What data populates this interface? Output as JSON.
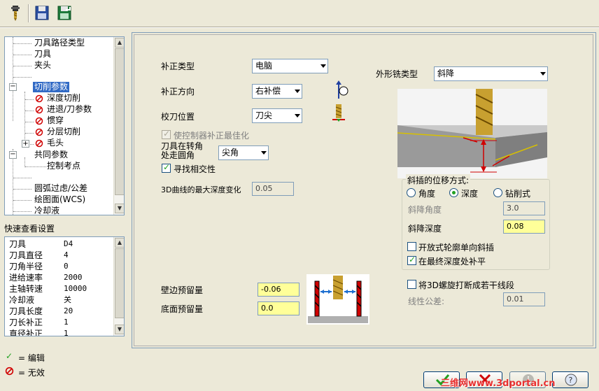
{
  "tree": {
    "items": [
      {
        "label": "刀具路径类型"
      },
      {
        "label": "刀具"
      },
      {
        "label": "夹头"
      },
      {
        "label": "切削参数"
      },
      {
        "label": "深度切削"
      },
      {
        "label": "进退/刀参数"
      },
      {
        "label": "惯穿"
      },
      {
        "label": "分层切削"
      },
      {
        "label": "毛头"
      },
      {
        "label": "共同参数"
      },
      {
        "label": "控制考点"
      },
      {
        "label": "圆弧过虑/公差"
      },
      {
        "label": "绘图面(WCS)"
      },
      {
        "label": "冷却液"
      }
    ],
    "expand_minus": "−",
    "expand_plus": "+"
  },
  "quick_view": {
    "title": "快速查看设置",
    "rows": [
      {
        "label": "刀具",
        "value": "D4"
      },
      {
        "label": "刀具直径",
        "value": "4"
      },
      {
        "label": "刀角半径",
        "value": "0"
      },
      {
        "label": "进给速率",
        "value": "2000"
      },
      {
        "label": "主轴转速",
        "value": "10000"
      },
      {
        "label": "冷却液",
        "value": "关"
      },
      {
        "label": "刀具长度",
        "value": "20"
      },
      {
        "label": "刀长补正",
        "value": "1"
      },
      {
        "label": "直径补正",
        "value": "1"
      }
    ]
  },
  "legend": {
    "edit_symbol": "✓",
    "edit_label": "= 编辑",
    "invalid_label": "= 无效"
  },
  "form": {
    "comp_type_label": "补正类型",
    "comp_type_value": "电脑",
    "comp_dir_label": "补正方向",
    "comp_dir_value": "右补偿",
    "tip_label": "校刀位置",
    "tip_value": "刀尖",
    "optimize_label": "使控制器补正最佳化",
    "roll_label_1": "刀具在转角",
    "roll_label_2": "处走圆角",
    "roll_value": "尖角",
    "intersect_label": "寻找相交性",
    "max_depth_label": "3D曲线的最大深度变化",
    "max_depth_value": "0.05",
    "wall_stock_label": "壁边预留量",
    "wall_stock_value": "-0.06",
    "floor_stock_label": "底面预留量",
    "floor_stock_value": "0.0",
    "contour_type_label": "外形铣类型",
    "contour_type_value": "斜降"
  },
  "ramp": {
    "group_title": "斜插的位移方式:",
    "opt_angle": "角度",
    "opt_depth": "深度",
    "opt_plunge": "钻削式",
    "ramp_angle_label": "斜降角度",
    "ramp_angle_value": "3.0",
    "ramp_depth_label": "斜降深度",
    "ramp_depth_value": "0.08",
    "open_contour_label": "开放式轮廓单向斜插",
    "final_depth_label": "在最终深度处补平",
    "linearize_label": "将3D螺旋打断成若干线段",
    "linear_tol_label": "线性公差:",
    "linear_tol_value": "0.01"
  },
  "watermark": "三维网www.3dportal.cn",
  "colors": {
    "highlight": "#316ac5",
    "invalid_red": "#d00000",
    "edit_green": "#21a121",
    "stock_yellow": "#ffff99",
    "tool_gold": "#c8a030"
  },
  "icons": [
    "tool-icon",
    "save-icon",
    "save-as-icon",
    "red-circle-slash-icon",
    "checkmark-icon",
    "help-icon",
    "cancel-icon",
    "info-icon"
  ]
}
